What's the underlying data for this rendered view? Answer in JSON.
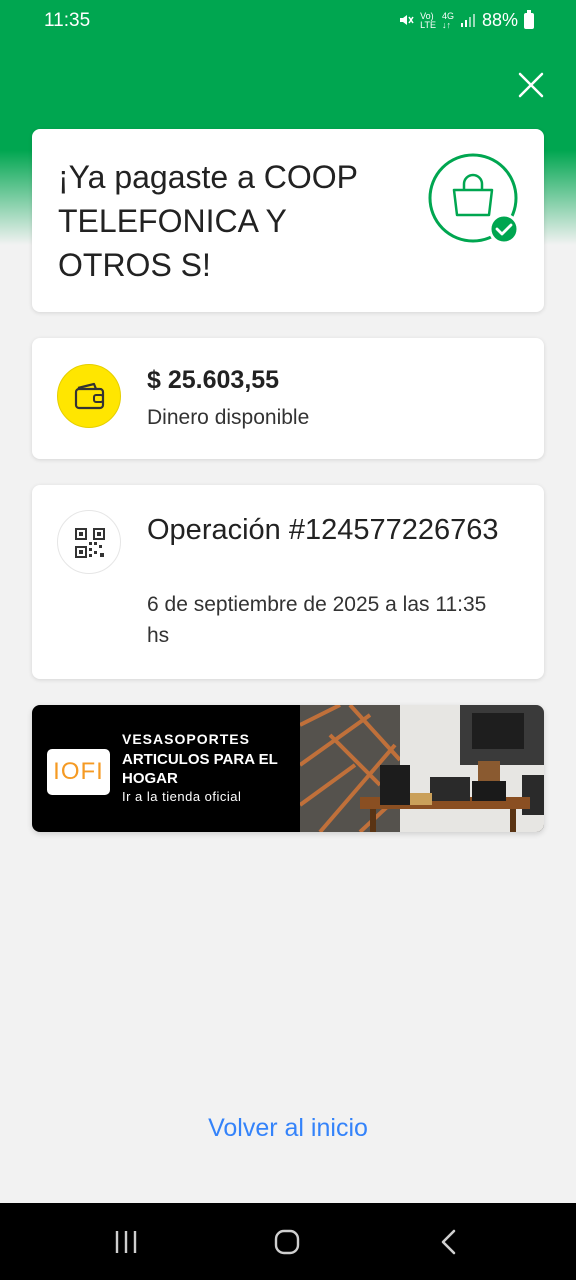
{
  "status_bar": {
    "time": "11:35",
    "battery": "88%",
    "icons": [
      "mute-icon",
      "volte-icon",
      "4g-icon",
      "signal-icon",
      "battery-icon"
    ],
    "network_labels": {
      "volte_top": "Vo)",
      "volte_bottom": "LTE",
      "net_top": "4G",
      "net_bottom": "↓↑"
    }
  },
  "header": {
    "close_icon": "close-icon"
  },
  "success_card": {
    "title": "¡Ya pagaste a COOP TELEFONICA Y OTROS S!",
    "icon": "shopping-bag-check-icon",
    "accent_color": "#00a650"
  },
  "balance_card": {
    "amount": "$ 25.603,55",
    "label": "Dinero disponible",
    "icon": "wallet-icon",
    "icon_bg": "#ffe600"
  },
  "operation_card": {
    "title": "Operación #124577226763",
    "date": "6 de septiembre de 2025 a las 11:35 hs",
    "icon": "qr-code-icon"
  },
  "banner": {
    "logo_text": "IOFI",
    "brand": "VESASOPORTES",
    "headline": "ARTICULOS PARA EL HOGAR",
    "link": "Ir a la tienda oficial"
  },
  "footer": {
    "back_label": "Volver al inicio",
    "link_color": "#3483fa"
  },
  "nav_bar": {
    "buttons": [
      "recents-icon",
      "home-icon",
      "back-icon"
    ]
  }
}
